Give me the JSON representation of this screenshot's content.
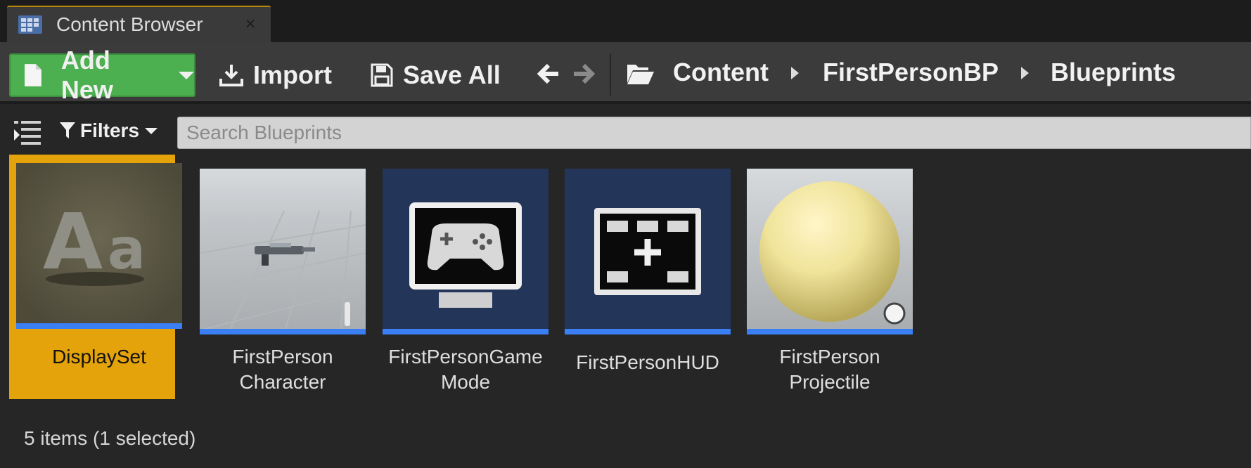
{
  "tab": {
    "title": "Content Browser",
    "close_glyph": "×"
  },
  "toolbar": {
    "add_new_label": "Add New",
    "import_label": "Import",
    "save_all_label": "Save All",
    "breadcrumb": [
      "Content",
      "FirstPersonBP",
      "Blueprints"
    ]
  },
  "filter": {
    "filters_label": "Filters",
    "search_placeholder": "Search Blueprints"
  },
  "assets": [
    {
      "name_line1": "DisplaySet",
      "name_line2": "",
      "thumb": "font-asset",
      "selected": true
    },
    {
      "name_line1": "FirstPerson",
      "name_line2": "Character",
      "thumb": "character-gun",
      "selected": false
    },
    {
      "name_line1": "FirstPersonGame",
      "name_line2": "Mode",
      "thumb": "gamemode-monitor",
      "selected": false
    },
    {
      "name_line1": "FirstPersonHUD",
      "name_line2": "",
      "thumb": "hud-screen",
      "selected": false
    },
    {
      "name_line1": "FirstPerson",
      "name_line2": "Projectile",
      "thumb": "yellow-sphere",
      "selected": false
    }
  ],
  "status": {
    "text": "5 items (1 selected)"
  },
  "colors": {
    "accent_selected": "#e4a30b",
    "add_new_green": "#4caf50",
    "asset_bar_blue": "#3b7ff5"
  }
}
